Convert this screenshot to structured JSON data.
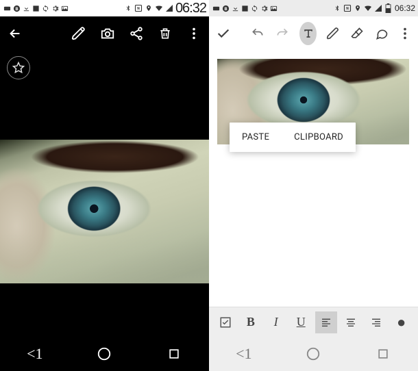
{
  "status": {
    "clock": "06:32"
  },
  "context_menu": {
    "paste": "PASTE",
    "clipboard": "CLIPBOARD"
  },
  "format": {
    "bold": "B",
    "italic": "I",
    "underline": "U",
    "bullet": "●"
  },
  "nav": {
    "back_label": "<1"
  }
}
